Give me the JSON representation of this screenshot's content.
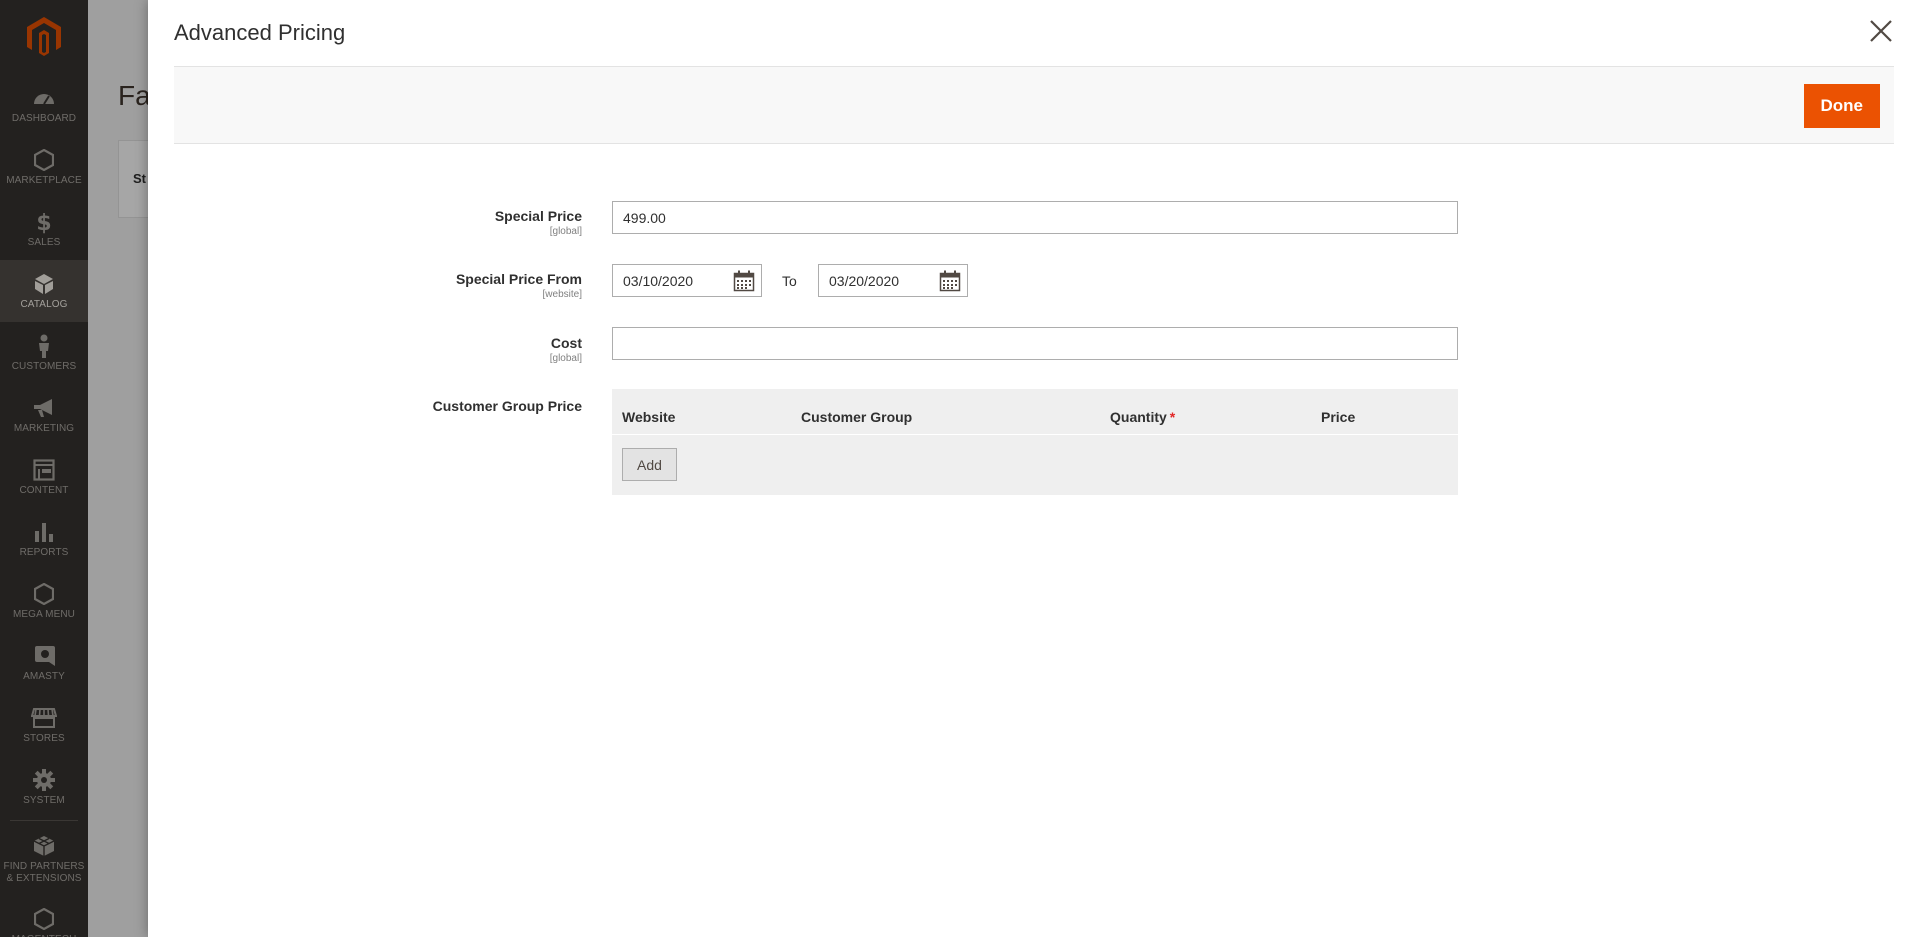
{
  "menu": {
    "items": [
      {
        "label": "Dashboard",
        "icon": "dashboard-icon"
      },
      {
        "label": "Marketplace",
        "icon": "hexagon-icon"
      },
      {
        "label": "Sales",
        "icon": "dollar-icon"
      },
      {
        "label": "Catalog",
        "icon": "box-icon",
        "active": true
      },
      {
        "label": "Customers",
        "icon": "person-icon"
      },
      {
        "label": "Marketing",
        "icon": "megaphone-icon"
      },
      {
        "label": "Content",
        "icon": "layout-icon"
      },
      {
        "label": "Reports",
        "icon": "bar-chart-icon"
      },
      {
        "label": "Mega Menu",
        "icon": "hexagon-icon"
      },
      {
        "label": "Amasty",
        "icon": "amasty-icon"
      },
      {
        "label": "Stores",
        "icon": "store-icon"
      },
      {
        "label": "System",
        "icon": "gear-icon"
      },
      {
        "label": "Find Partners & Extensions",
        "icon": "cubes-icon"
      },
      {
        "label": "Magentech",
        "icon": "hexagon-icon"
      }
    ]
  },
  "background": {
    "page_title": "Fa",
    "store_label": "St"
  },
  "modal": {
    "title": "Advanced Pricing",
    "done_label": "Done",
    "fields": {
      "special_price": {
        "label": "Special Price",
        "scope": "[global]",
        "value": "499.00"
      },
      "special_price_from": {
        "label": "Special Price From",
        "scope": "[website]",
        "from_value": "03/10/2020",
        "to_label": "To",
        "to_value": "03/20/2020"
      },
      "cost": {
        "label": "Cost",
        "scope": "[global]",
        "value": ""
      },
      "customer_group_price": {
        "label": "Customer Group Price",
        "columns": [
          "Website",
          "Customer Group",
          "Quantity",
          "Price"
        ],
        "required_marker": "*",
        "add_label": "Add"
      }
    }
  },
  "colors": {
    "accent": "#eb5202",
    "menu_bg": "#373330",
    "menu_active": "#524d49"
  }
}
